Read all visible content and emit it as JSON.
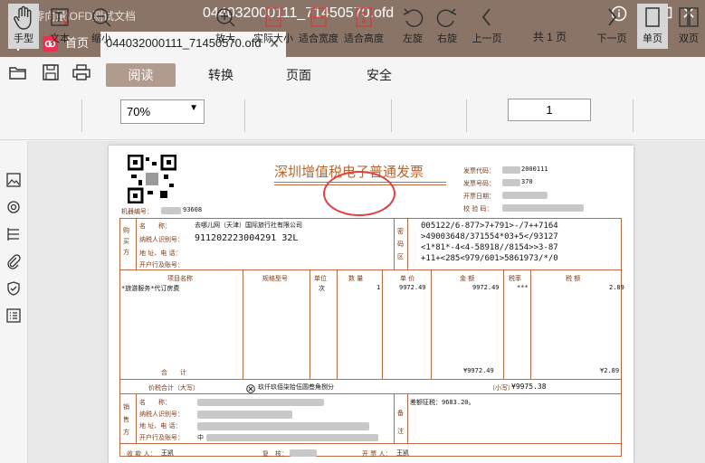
{
  "titlebar": {
    "path": "D:\\零向量\\OFD测试文档",
    "document_title": "044032000111_71450570.ofd",
    "controls": [
      "info-icon",
      "minimize-icon",
      "maximize-icon",
      "close-icon"
    ]
  },
  "tabs": {
    "home_label": "首页",
    "doc_label": "044032000111_71450570.ofd"
  },
  "menu": {
    "items": [
      "阅读",
      "转换",
      "页面",
      "安全"
    ],
    "active": "阅读"
  },
  "toolbar": {
    "hand": "手型",
    "text": "文本",
    "zoom_out": "缩小",
    "zoom_value": "70%",
    "zoom_in": "放大",
    "actual_size": "实际大小",
    "fit_width": "适合宽度",
    "fit_height": "适合高度",
    "rotate_left": "左旋",
    "rotate_right": "右旋",
    "prev_page": "上一页",
    "page_current": "1",
    "page_total": "共 1 页",
    "next_page": "下一页",
    "single_page": "单页",
    "double_page": "双页"
  },
  "sidebar": {
    "icons": [
      "thumbnail-icon",
      "layers-icon",
      "outline-icon",
      "attachment-icon",
      "signature-icon",
      "list-icon"
    ]
  },
  "invoice": {
    "title": "深圳增值税电子普通发票",
    "invoice_code_label": "发票代码：",
    "invoice_code_tail": "2000111",
    "invoice_number_label": "发票号码：",
    "invoice_number_tail": "370",
    "issue_date_label": "开票日期：",
    "check_code_label": "校 验 码：",
    "machine_no_label": "机器编号：",
    "machine_no_tail": "93608",
    "buyer_side": "购买方",
    "name_label": "名　　称：",
    "buyer_name": "去哪儿网（天津）国际旅行社有限公司",
    "taxid_label": "纳税人识别号：",
    "buyer_taxid": "911202223004291 32L",
    "addr_label": "地 址、电 话：",
    "bank_label": "开户行及账号：",
    "cipher_side": "密码区",
    "cipher_lines": [
      "005122/6-877>7+791>-/7++7164",
      ">49003648/371554*03+5</93127",
      "<1*81*-4<4-58918//8154>>3-87",
      "+11+<285<979/601>5861973/*/0"
    ],
    "col_item": "项目名称",
    "col_spec": "规格型号",
    "col_unit": "单位",
    "col_qty": "数 量",
    "col_price": "单 价",
    "col_amount": "金 额",
    "col_rate": "税率",
    "col_tax": "税 额",
    "item_name": "*旅游服务*代订房费",
    "item_unit": "次",
    "item_qty": "1",
    "item_price": "9972.49",
    "item_amount": "9972.49",
    "item_rate": "***",
    "item_tax": "2.89",
    "total_label": "合　　计",
    "total_amount": "¥9972.49",
    "total_tax": "¥2.89",
    "price_tax_label": "价税合计（大写）",
    "price_tax_words": "玖仟玖佰柒拾伍圆叁角捌分",
    "price_tax_small_label": "（小写）",
    "price_tax_small": "¥9975.38",
    "seller_side": "销售方",
    "remark_side": "备注",
    "remark_text": "差额征税：9683.20。",
    "payee_label": "收 款 人：",
    "payee": "王凯",
    "reviewer_label": "复　核：",
    "drawer_label": "开 票 人：",
    "drawer": "王凯",
    "seller_bank_prefix": "中"
  },
  "colors": {
    "titlebar": "#8a7468",
    "menu_active": "#b19b8e",
    "invoice_ink": "#b86b45",
    "seal": "#e04040"
  }
}
